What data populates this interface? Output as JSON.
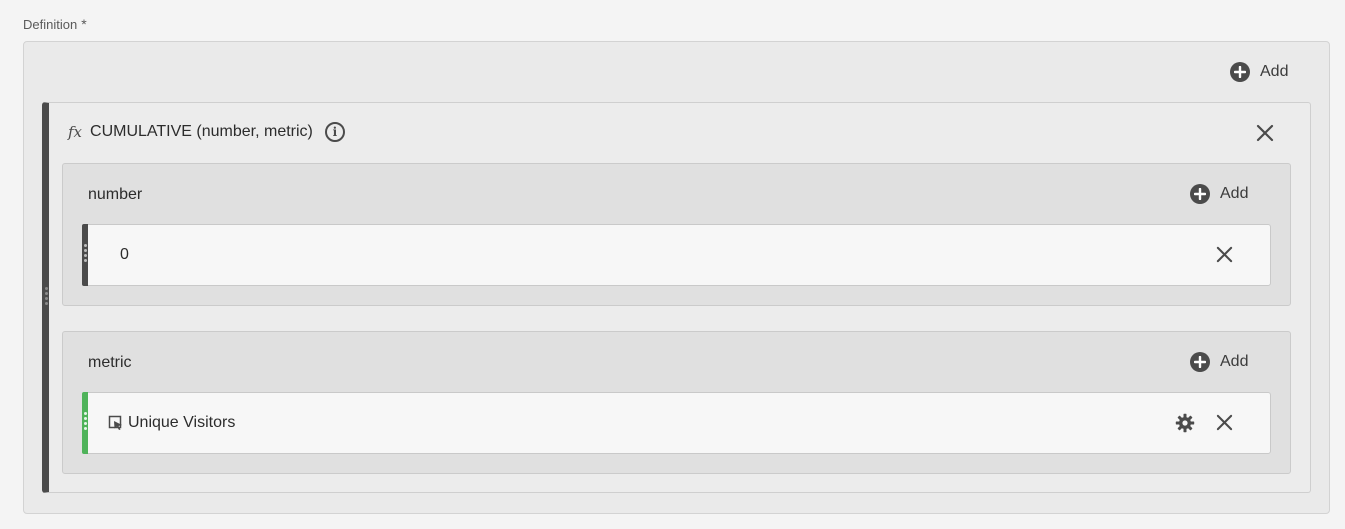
{
  "definition": {
    "label": "Definition",
    "required_marker": "*"
  },
  "toolbar": {
    "add_label": "Add"
  },
  "function": {
    "name": "CUMULATIVE (number, metric)",
    "fx_symbol": "fx",
    "info_symbol": "i"
  },
  "params": [
    {
      "label": "number",
      "add_label": "Add",
      "value": "0",
      "bar_color": "#4b4b4b"
    },
    {
      "label": "metric",
      "add_label": "Add",
      "value": "Unique Visitors",
      "bar_color": "#4fb35a",
      "icon": "metric-icon",
      "has_settings": true
    }
  ],
  "icons": {
    "add": "plus-circle-icon",
    "close": "close-icon",
    "info": "info-icon",
    "settings": "gear-icon",
    "drag": "drag-handle-icon"
  },
  "colors": {
    "accent_dark": "#4b4b4b",
    "metric_green": "#4fb35a",
    "background": "#f4f4f4"
  }
}
